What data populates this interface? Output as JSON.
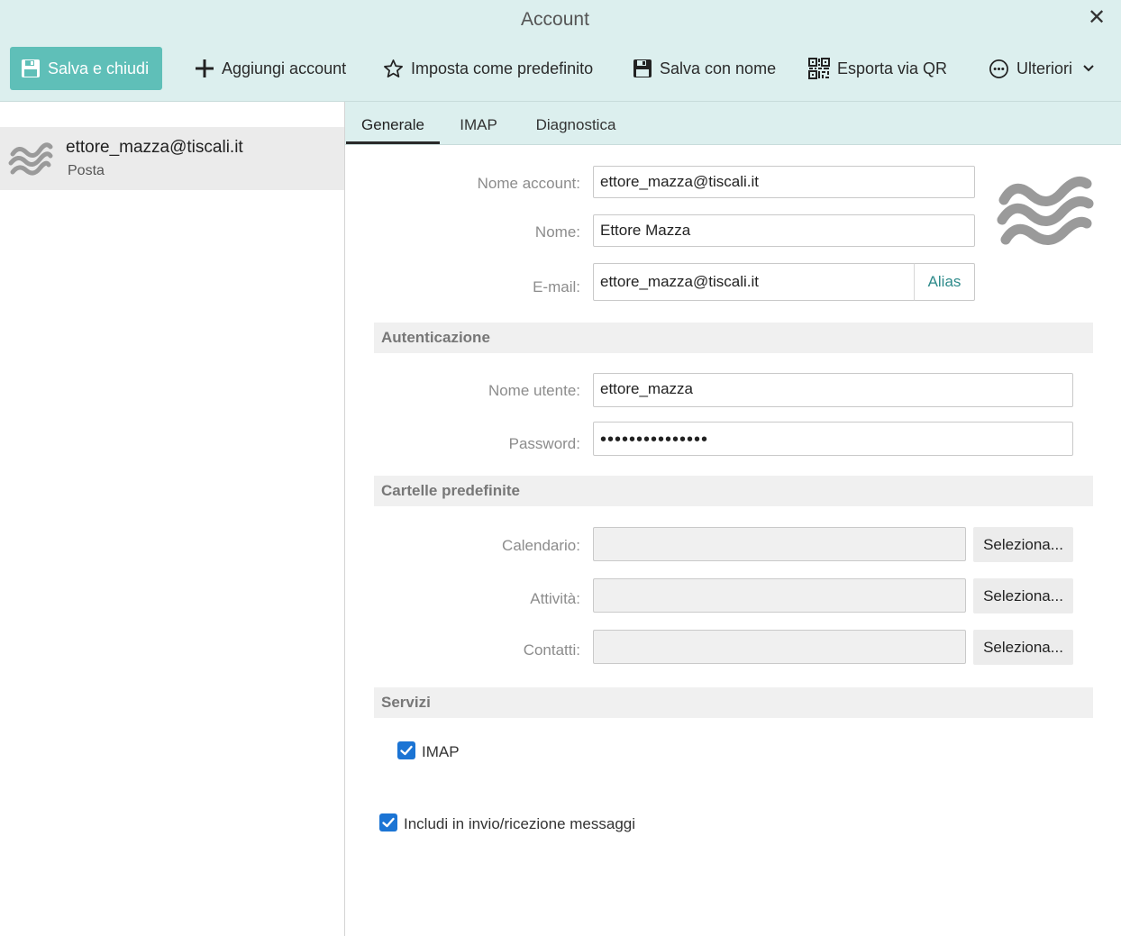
{
  "window": {
    "title": "Account"
  },
  "toolbar": {
    "save_close": "Salva e chiudi",
    "add_account": "Aggiungi account",
    "set_default": "Imposta come predefinito",
    "save_as": "Salva con nome",
    "export_qr": "Esporta via QR",
    "more": "Ulteriori"
  },
  "accounts": [
    {
      "email": "ettore_mazza@tiscali.it",
      "type": "Posta"
    }
  ],
  "tabs": [
    "Generale",
    "IMAP",
    "Diagnostica"
  ],
  "general": {
    "account_name_label": "Nome account:",
    "account_name": "ettore_mazza@tiscali.it",
    "name_label": "Nome:",
    "name": "Ettore Mazza",
    "email_label": "E-mail:",
    "email": "ettore_mazza@tiscali.it",
    "alias": "Alias"
  },
  "auth": {
    "section": "Autenticazione",
    "username_label": "Nome utente:",
    "username": "ettore_mazza",
    "password_label": "Password:",
    "password": "•••••••••••••••"
  },
  "folders": {
    "section": "Cartelle predefinite",
    "calendar_label": "Calendario:",
    "tasks_label": "Attività:",
    "contacts_label": "Contatti:",
    "select": "Seleziona..."
  },
  "services": {
    "section": "Servizi",
    "imap": "IMAP",
    "include": "Includi in invio/ricezione messaggi"
  },
  "colors": {
    "accent": "#5fbfb8",
    "header": "#dcefee",
    "checkbox": "#1b74d4"
  }
}
